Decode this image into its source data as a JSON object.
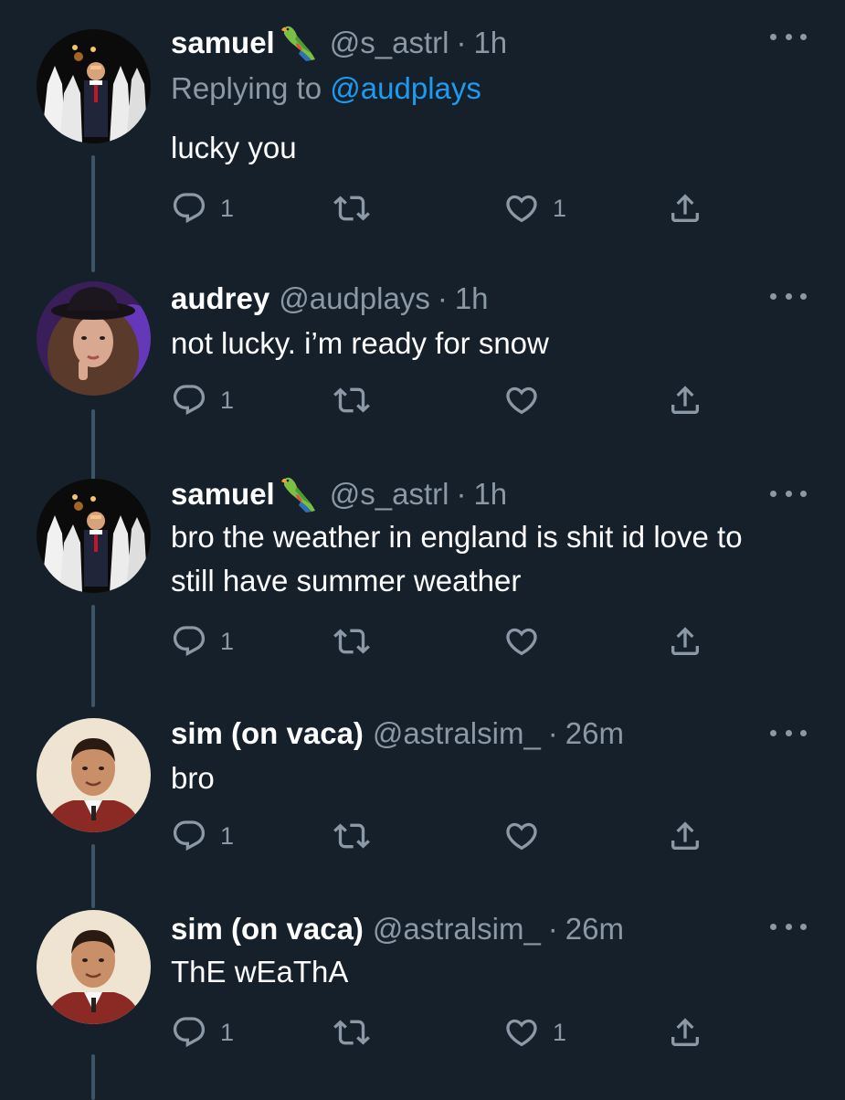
{
  "colors": {
    "background": "#15202b",
    "text_primary": "#ffffff",
    "text_secondary": "#8b98a5",
    "link": "#1d9bf0",
    "thread_line": "#3d5466"
  },
  "tweets": [
    {
      "name": "samuel",
      "badge_icon": "parrot-emoji",
      "handle": "@s_astrl",
      "dot": "·",
      "time": "1h",
      "reply_prefix": "Replying to",
      "reply_mention": "@audplays",
      "text": "lucky you",
      "replies": "1",
      "retweets": "",
      "likes": "1",
      "avatar_icon": "avatar-samuel"
    },
    {
      "name": "audrey",
      "handle": "@audplays",
      "dot": "·",
      "time": "1h",
      "text": "not lucky. i’m ready for snow",
      "replies": "1",
      "retweets": "",
      "likes": "",
      "avatar_icon": "avatar-audrey"
    },
    {
      "name": "samuel",
      "badge_icon": "parrot-emoji",
      "handle": "@s_astrl",
      "dot": "·",
      "time": "1h",
      "text": "bro the weather in england is shit id love to still have summer weather",
      "replies": "1",
      "retweets": "",
      "likes": "",
      "avatar_icon": "avatar-samuel"
    },
    {
      "name": "sim (on vaca)",
      "handle": "@astralsim_",
      "dot": "·",
      "time": "26m",
      "text": "bro",
      "replies": "1",
      "retweets": "",
      "likes": "",
      "avatar_icon": "avatar-sim"
    },
    {
      "name": "sim (on vaca)",
      "handle": "@astralsim_",
      "dot": "·",
      "time": "26m",
      "text": "ThE wEaThA",
      "replies": "1",
      "retweets": "",
      "likes": "1",
      "avatar_icon": "avatar-sim"
    }
  ]
}
